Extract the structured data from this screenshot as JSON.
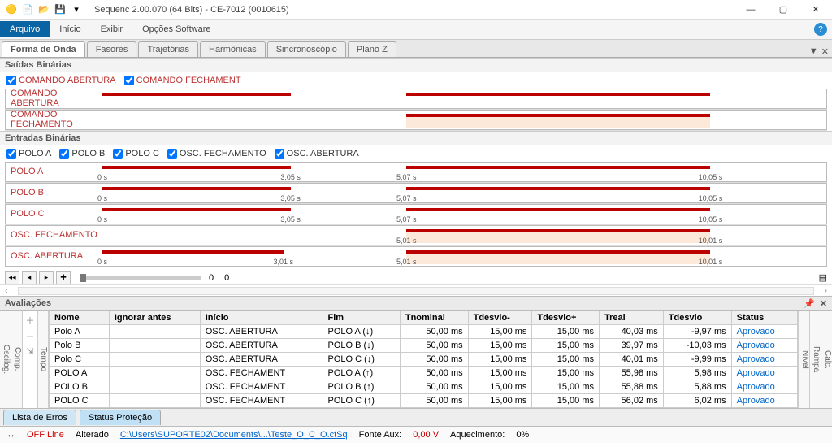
{
  "title": "Sequenc 2.00.070 (64 Bits) - CE-7012 (0010615)",
  "menu": {
    "arquivo": "Arquivo",
    "inicio": "Início",
    "exibir": "Exibir",
    "opcoes": "Opções Software"
  },
  "tabs": {
    "forma": "Forma de Onda",
    "fasores": "Fasores",
    "traj": "Trajetórias",
    "harm": "Harmônicas",
    "sinc": "Sincronoscópio",
    "planoz": "Plano Z"
  },
  "saidas": {
    "h": "Saídas Binárias",
    "c1": "COMANDO ABERTURA",
    "c2": "COMANDO FECHAMENT",
    "r1": "COMANDO ABERTURA",
    "r2": "COMANDO FECHAMENTO"
  },
  "entradas": {
    "h": "Entradas Binárias",
    "pa": "POLO A",
    "pb": "POLO B",
    "pc": "POLO C",
    "of": "OSC. FECHAMENTO",
    "oa": "OSC. ABERTURA"
  },
  "ticks": {
    "t0": "0 s",
    "t305": "3,05 s",
    "t301": "3,01 s",
    "t507": "5,07 s",
    "t501": "5,01 s",
    "t1005": "10,05 s",
    "t1001": "10,01 s"
  },
  "ruler": {
    "a": "0",
    "b": "0"
  },
  "aval": {
    "h": "Avaliações",
    "cols": {
      "nome": "Nome",
      "ign": "Ignorar antes",
      "ini": "Início",
      "fim": "Fim",
      "tnom": "Tnominal",
      "tdm": "Tdesvio-",
      "tdp": "Tdesvio+",
      "treal": "Treal",
      "tdes": "Tdesvio",
      "stat": "Status"
    },
    "rows": [
      {
        "n": "Polo A",
        "ini": "OSC. ABERTURA",
        "fim": "POLO A  (↓)",
        "tn": "50,00 ms",
        "dm": "15,00 ms",
        "dp": "15,00 ms",
        "tr": "40,03 ms",
        "td": "-9,97 ms",
        "st": "Aprovado"
      },
      {
        "n": "Polo B",
        "ini": "OSC. ABERTURA",
        "fim": "POLO B  (↓)",
        "tn": "50,00 ms",
        "dm": "15,00 ms",
        "dp": "15,00 ms",
        "tr": "39,97 ms",
        "td": "-10,03 ms",
        "st": "Aprovado"
      },
      {
        "n": "Polo C",
        "ini": "OSC. ABERTURA",
        "fim": "POLO C  (↓)",
        "tn": "50,00 ms",
        "dm": "15,00 ms",
        "dp": "15,00 ms",
        "tr": "40,01 ms",
        "td": "-9,99 ms",
        "st": "Aprovado"
      },
      {
        "n": "POLO A",
        "ini": "OSC. FECHAMENT",
        "fim": "POLO A  (↑)",
        "tn": "50,00 ms",
        "dm": "15,00 ms",
        "dp": "15,00 ms",
        "tr": "55,98 ms",
        "td": "5,98 ms",
        "st": "Aprovado"
      },
      {
        "n": "POLO B",
        "ini": "OSC. FECHAMENT",
        "fim": "POLO B  (↑)",
        "tn": "50,00 ms",
        "dm": "15,00 ms",
        "dp": "15,00 ms",
        "tr": "55,88 ms",
        "td": "5,88 ms",
        "st": "Aprovado"
      },
      {
        "n": "POLO C",
        "ini": "OSC. FECHAMENT",
        "fim": "POLO C  (↑)",
        "tn": "50,00 ms",
        "dm": "15,00 ms",
        "dp": "15,00 ms",
        "tr": "56,02 ms",
        "td": "6,02 ms",
        "st": "Aprovado"
      }
    ]
  },
  "vside": {
    "comp": "Comp.",
    "oscilog": "Oscilog.",
    "tempo": "Tempo",
    "nivel": "Nível",
    "rampa": "Rampa",
    "calc": "Calc."
  },
  "btabs": {
    "err": "Lista de Erros",
    "prot": "Status Proteção"
  },
  "status": {
    "off": "OFF Line",
    "alt": "Alterado",
    "path": "C:\\Users\\SUPORTE02\\Documents\\...\\Teste_O_C_O.ctSq",
    "fonte": "Fonte Aux:",
    "fontev": "0,00 V",
    "aq": "Aquecimento:",
    "aqv": "0%"
  },
  "chart_data": {
    "type": "timeline",
    "x_unit": "s",
    "tracks": [
      {
        "name": "COMANDO ABERTURA",
        "high": [
          [
            0,
            3.05
          ],
          [
            5.07,
            10.05
          ]
        ]
      },
      {
        "name": "COMANDO FECHAMENTO",
        "high": [
          [
            5.07,
            10.05
          ]
        ]
      },
      {
        "name": "POLO A",
        "high": [
          [
            0,
            3.05
          ],
          [
            5.07,
            10.05
          ]
        ],
        "ticks": [
          0,
          3.05,
          5.07,
          10.05
        ]
      },
      {
        "name": "POLO B",
        "high": [
          [
            0,
            3.05
          ],
          [
            5.07,
            10.05
          ]
        ],
        "ticks": [
          0,
          3.05,
          5.07,
          10.05
        ]
      },
      {
        "name": "POLO C",
        "high": [
          [
            0,
            3.05
          ],
          [
            5.07,
            10.05
          ]
        ],
        "ticks": [
          0,
          3.05,
          5.07,
          10.05
        ]
      },
      {
        "name": "OSC. FECHAMENTO",
        "high": [
          [
            5.01,
            10.01
          ]
        ],
        "ticks": [
          5.01,
          10.01
        ]
      },
      {
        "name": "OSC. ABERTURA",
        "high": [
          [
            0,
            3.01
          ],
          [
            5.01,
            10.01
          ]
        ],
        "ticks": [
          0,
          3.01,
          5.01,
          10.01
        ]
      }
    ],
    "x_range": [
      0,
      12
    ]
  }
}
